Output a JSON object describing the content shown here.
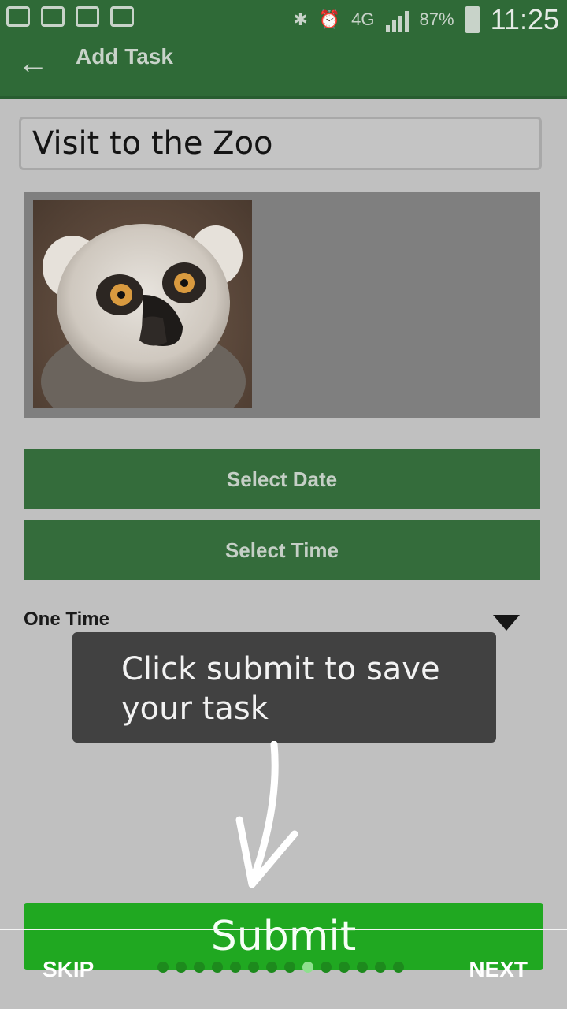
{
  "status_bar": {
    "battery_percent": "87%",
    "network": "4G",
    "time": "11:25"
  },
  "app_bar": {
    "title": "Add Task"
  },
  "form": {
    "task_title": "Visit to the Zoo",
    "select_date_label": "Select Date",
    "select_time_label": "Select Time",
    "repeat_value": "One Time",
    "submit_label": "Submit"
  },
  "tutorial": {
    "tooltip_text": "Click submit to save your task",
    "skip_label": "SKIP",
    "next_label": "NEXT",
    "total_steps": 14,
    "current_step": 9
  },
  "colors": {
    "app_bar": "#2f6a37",
    "buttons": "#346c3b",
    "submit": "#20a821",
    "tooltip": "#414141",
    "overlay_background": "#c0c0c0"
  }
}
